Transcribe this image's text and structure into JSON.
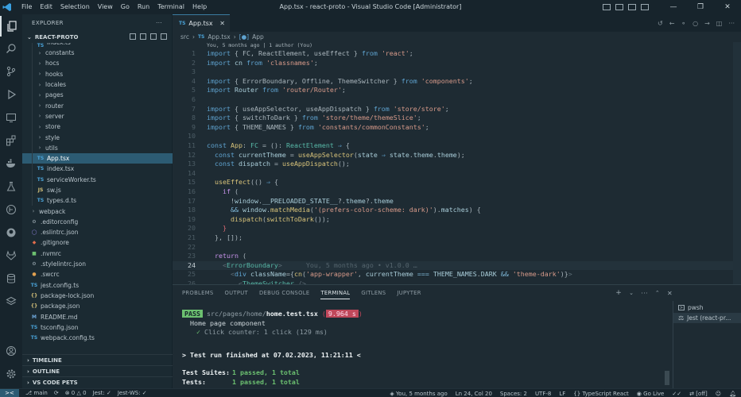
{
  "window": {
    "title": "App.tsx - react-proto - Visual Studio Code [Administrator]",
    "menu": [
      "File",
      "Edit",
      "Selection",
      "View",
      "Go",
      "Run",
      "Terminal",
      "Help"
    ]
  },
  "sidebar": {
    "header": "EXPLORER",
    "project": "REACT-PROTO",
    "items": [
      {
        "label": "index.ts",
        "type": "ts",
        "indent": 2
      },
      {
        "label": "constants",
        "type": "folder",
        "indent": 2
      },
      {
        "label": "hocs",
        "type": "folder",
        "indent": 2
      },
      {
        "label": "hooks",
        "type": "folder",
        "indent": 2
      },
      {
        "label": "locales",
        "type": "folder",
        "indent": 2
      },
      {
        "label": "pages",
        "type": "folder",
        "indent": 2
      },
      {
        "label": "router",
        "type": "folder",
        "indent": 2
      },
      {
        "label": "server",
        "type": "folder",
        "indent": 2
      },
      {
        "label": "store",
        "type": "folder",
        "indent": 2
      },
      {
        "label": "style",
        "type": "folder",
        "indent": 2
      },
      {
        "label": "utils",
        "type": "folder",
        "indent": 2
      },
      {
        "label": "App.tsx",
        "type": "ts",
        "indent": 2,
        "selected": true
      },
      {
        "label": "index.tsx",
        "type": "ts",
        "indent": 2
      },
      {
        "label": "serviceWorker.ts",
        "type": "ts",
        "indent": 2
      },
      {
        "label": "sw.js",
        "type": "js",
        "indent": 2
      },
      {
        "label": "types.d.ts",
        "type": "ts",
        "indent": 2
      },
      {
        "label": "webpack",
        "type": "folder",
        "indent": 1
      },
      {
        "label": ".editorconfig",
        "type": "cfg",
        "indent": 1
      },
      {
        "label": ".eslintrc.json",
        "type": "eslint",
        "indent": 1
      },
      {
        "label": ".gitignore",
        "type": "git",
        "indent": 1
      },
      {
        "label": ".nvmrc",
        "type": "nvm",
        "indent": 1
      },
      {
        "label": ".stylelintrc.json",
        "type": "cfg",
        "indent": 1
      },
      {
        "label": ".swcrc",
        "type": "swc",
        "indent": 1
      },
      {
        "label": "jest.config.ts",
        "type": "ts",
        "indent": 1
      },
      {
        "label": "package-lock.json",
        "type": "json",
        "indent": 1
      },
      {
        "label": "package.json",
        "type": "json",
        "indent": 1
      },
      {
        "label": "README.md",
        "type": "md",
        "indent": 1
      },
      {
        "label": "tsconfig.json",
        "type": "ts",
        "indent": 1
      },
      {
        "label": "webpack.config.ts",
        "type": "ts",
        "indent": 1
      }
    ],
    "sections": [
      "TIMELINE",
      "OUTLINE",
      "VS CODE PETS"
    ]
  },
  "editor": {
    "tab": {
      "badge": "TS",
      "label": "App.tsx"
    },
    "breadcrumb": {
      "folder": "src",
      "file": "App.tsx",
      "symbol": "App"
    },
    "blame_top": "You, 5 months ago | 1 author (You)",
    "blame_line": "You, 5 months ago • v1.0.0 …",
    "lines": [
      {
        "n": "1"
      },
      {
        "n": "2"
      },
      {
        "n": "3"
      },
      {
        "n": "4"
      },
      {
        "n": "5"
      },
      {
        "n": "6"
      },
      {
        "n": "7"
      },
      {
        "n": "8"
      },
      {
        "n": "9"
      },
      {
        "n": "10"
      },
      {
        "n": "11"
      },
      {
        "n": "12"
      },
      {
        "n": "13"
      },
      {
        "n": "14"
      },
      {
        "n": "15"
      },
      {
        "n": "16"
      },
      {
        "n": "17"
      },
      {
        "n": "18"
      },
      {
        "n": "19"
      },
      {
        "n": "20"
      },
      {
        "n": "21"
      },
      {
        "n": "22"
      },
      {
        "n": "23"
      },
      {
        "n": "24"
      },
      {
        "n": "25"
      },
      {
        "n": "26"
      }
    ]
  },
  "panel": {
    "tabs": [
      "PROBLEMS",
      "OUTPUT",
      "DEBUG CONSOLE",
      "TERMINAL",
      "GITLENS",
      "JUPYTER"
    ],
    "active_tab": "TERMINAL",
    "terminal": {
      "pass": "PASS",
      "test_dir": "src/pages/home/",
      "test_file": "home.test.tsx",
      "duration": "9.964 s",
      "suite": "Home page component",
      "case": "Click counter: 1 click (129 ms)",
      "finished": "> Test run finished at 07.02.2023, 11:21:11 <",
      "suites_label": "Test Suites:",
      "suites_value": "1 passed, 1 total",
      "tests_label": "Tests:",
      "tests_value": "1 passed, 1 total"
    },
    "terminals": [
      "pwsh",
      "Jest (react-pr..."
    ]
  },
  "status": {
    "branch": "main",
    "errors": "0",
    "warnings": "0",
    "jest": "Jest: ",
    "jest_ws": "Jest-WS: ",
    "blame": "You, 5 months ago",
    "position": "Ln 24, Col 20",
    "spaces": "Spaces: 2",
    "encoding": "UTF-8",
    "eol": "LF",
    "language": "TypeScript React",
    "golive": "Go Live",
    "off": "[off]"
  },
  "colors": {
    "accent": "#2c5b73",
    "background": "#1e2b33"
  }
}
